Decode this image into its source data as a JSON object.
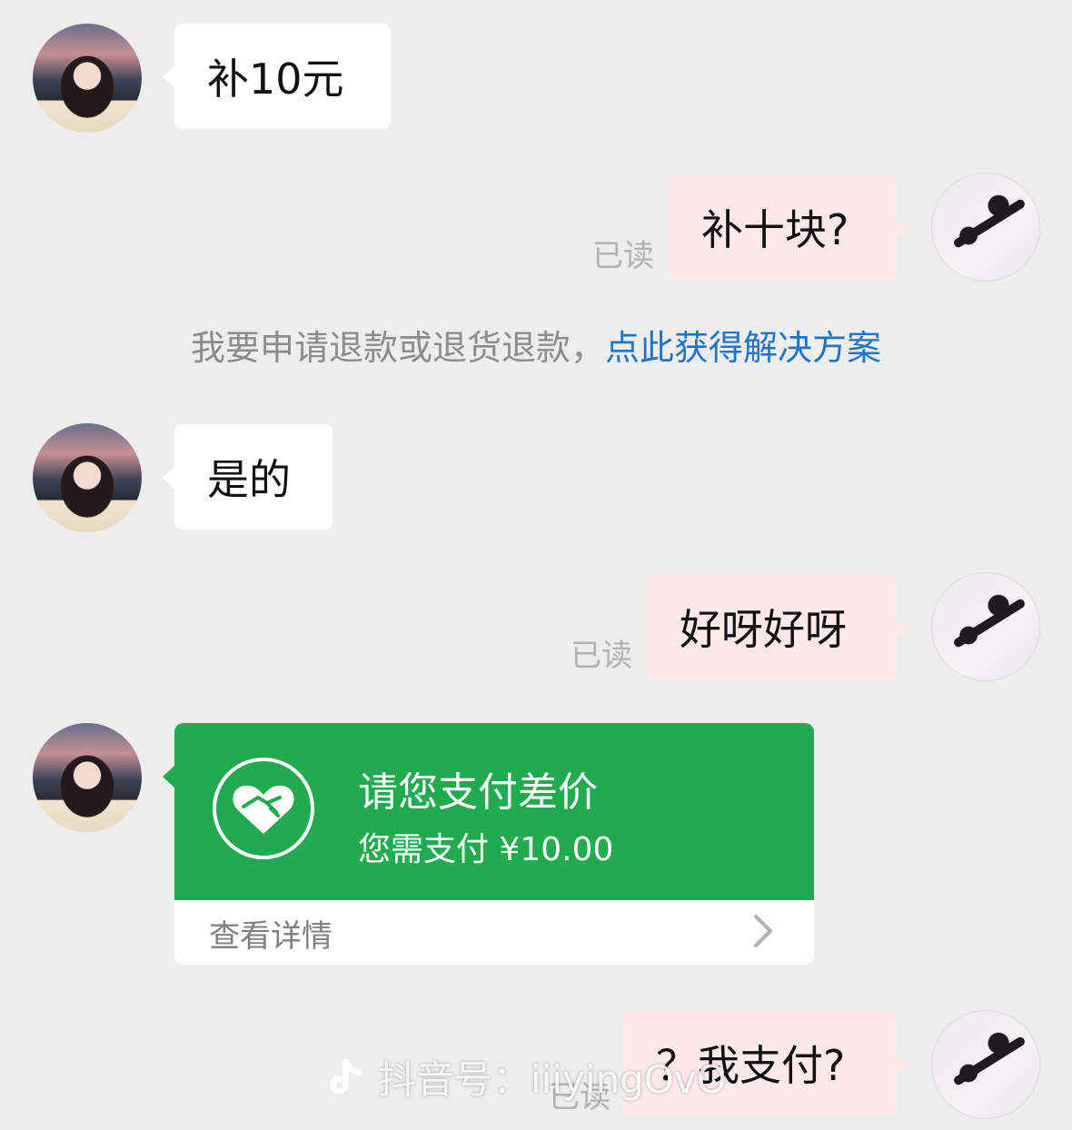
{
  "messages": [
    {
      "side": "left",
      "text": "补10元"
    },
    {
      "side": "right",
      "text": "补十块?",
      "read_status": "已读"
    },
    {
      "side": "left",
      "text": "是的"
    },
    {
      "side": "right",
      "text": "好呀好呀",
      "read_status": "已读"
    },
    {
      "side": "right",
      "text": "？我支付?",
      "read_status": "已读"
    }
  ],
  "system_message": {
    "text": "我要申请退款或退货退款，",
    "link": "点此获得解决方案"
  },
  "payment_card": {
    "title": "请您支付差价",
    "amount_text": "您需支付 ¥10.00",
    "details_link": "查看详情",
    "icon": "handshake-heart-icon"
  },
  "watermark": {
    "text": "抖音号：iiiyingOvO",
    "icon": "douyin-logo-icon"
  },
  "colors": {
    "background": "#ededed",
    "incoming_bubble": "#ffffff",
    "outgoing_bubble": "#fde9ea",
    "card_green": "#20ab4e",
    "link_blue": "#1f73c8",
    "read_gray": "#b2b2b2"
  }
}
